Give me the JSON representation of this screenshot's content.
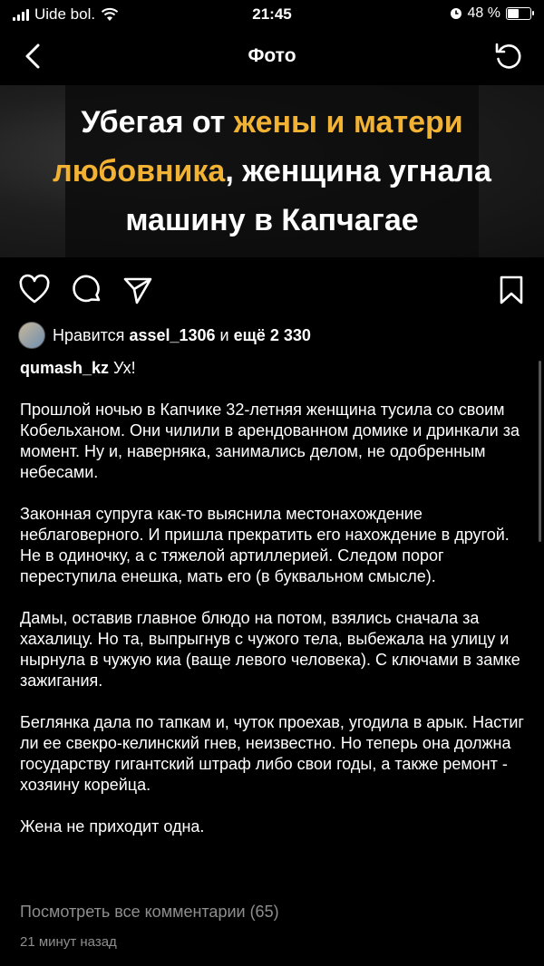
{
  "status_bar": {
    "carrier": "Uide bol.",
    "time": "21:45",
    "battery_percent": "48 %",
    "battery_level": 0.48
  },
  "nav": {
    "title": "Фото",
    "back_icon": "chevron-left-icon",
    "refresh_icon": "refresh-icon"
  },
  "post_image": {
    "line1_white": "Убегая от ",
    "line1_accent": "жены и матери",
    "line2_accent": "любовника",
    "line2_white": ", женщина угнала",
    "line3_white": "машину в Капчагае",
    "accent_color": "#f2b233"
  },
  "actions": {
    "like_icon": "heart-icon",
    "comment_icon": "comment-icon",
    "share_icon": "send-icon",
    "save_icon": "bookmark-icon"
  },
  "likes": {
    "prefix": "Нравится ",
    "user": "assel_1306",
    "middle": " и ",
    "rest": "ещё 2 330"
  },
  "caption": {
    "username": "qumash_kz",
    "first": " Ух!",
    "paragraphs": [
      "Прошлой ночью в Капчике 32-летняя женщина тусила со своим Кобельханом. Они чилили в арендованном домике и дринкали за момент. Ну и, наверняка, занимались делом, не одобренным небесами.",
      "Законная супруга как-то выяснила местонахождение неблаговерного. И пришла прекратить его нахождение в другой. Не в одиночку, а с тяжелой артиллерией. Следом порог переступила енешка, мать его (в буквальном смысле).",
      "Дамы, оставив главное блюдо на потом, взялись сначала за хахалицу. Но та, выпрыгнув с чужого тела, выбежала на улицу и нырнула в чужую киа (ваще левого человека). С ключами в замке зажигания.",
      "Беглянка дала по тапкам и, чуток проехав, угодила в арык. Настиг ли ее свекро-келинский гнев, неизвестно. Но теперь она должна государству гигантский штраф либо свои годы, а также ремонт - хозяину корейца.",
      "Жена не приходит одна."
    ]
  },
  "view_comments": "Посмотреть все комментарии (65)",
  "time_ago": "21 минут назад"
}
